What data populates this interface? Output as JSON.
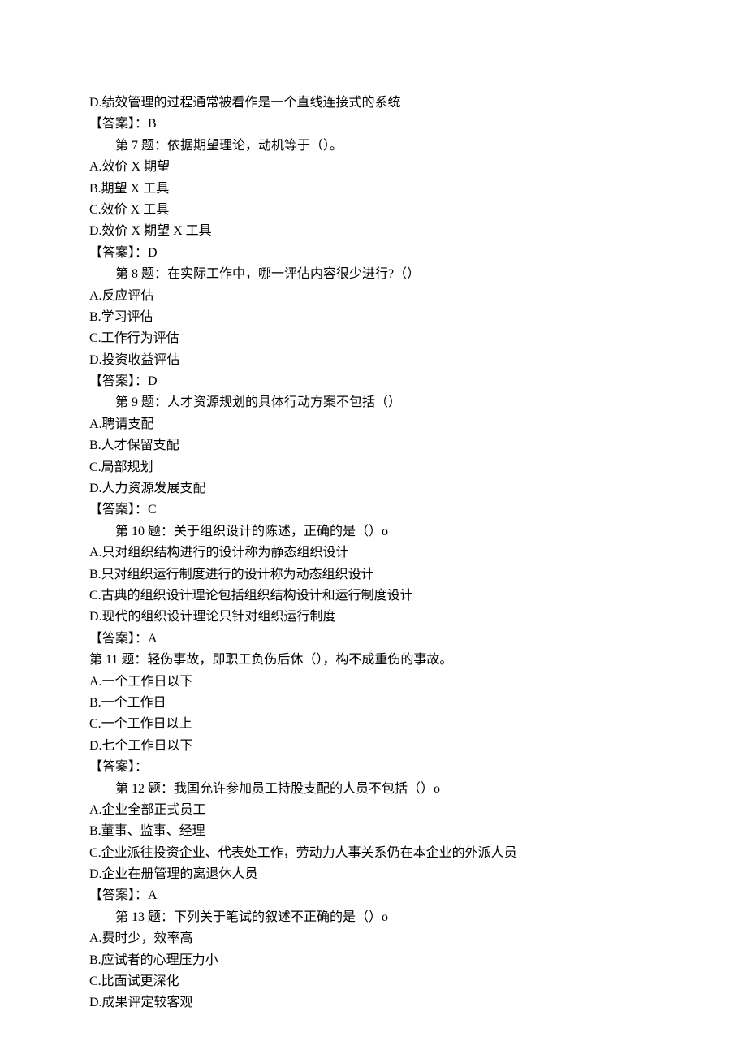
{
  "lines": [
    {
      "text": "D.绩效管理的过程通常被看作是一个直线连接式的系统",
      "indent": false
    },
    {
      "text": "【答案】：B",
      "indent": false
    },
    {
      "text": "第 7 题：依据期望理论，动机等于（）。",
      "indent": true
    },
    {
      "text": "A.效价 X 期望",
      "indent": false
    },
    {
      "text": "B.期望 X 工具",
      "indent": false
    },
    {
      "text": "C.效价 X 工具",
      "indent": false
    },
    {
      "text": "D.效价 X 期望 X 工具",
      "indent": false
    },
    {
      "text": "【答案】：D",
      "indent": false
    },
    {
      "text": "第 8 题：在实际工作中，哪一评估内容很少进行?（）",
      "indent": true
    },
    {
      "text": "A.反应评估",
      "indent": false
    },
    {
      "text": "B.学习评估",
      "indent": false
    },
    {
      "text": "C.工作行为评估",
      "indent": false
    },
    {
      "text": "D.投资收益评估",
      "indent": false
    },
    {
      "text": "【答案】：D",
      "indent": false
    },
    {
      "text": "第 9 题：人才资源规划的具体行动方案不包括（）",
      "indent": true
    },
    {
      "text": "A.聘请支配",
      "indent": false
    },
    {
      "text": "B.人才保留支配",
      "indent": false
    },
    {
      "text": "C.局部规划",
      "indent": false
    },
    {
      "text": "D.人力资源发展支配",
      "indent": false
    },
    {
      "text": "【答案】：C",
      "indent": false
    },
    {
      "text": "第 10 题：关于组织设计的陈述，正确的是（）o",
      "indent": true
    },
    {
      "text": "A.只对组织结构进行的设计称为静态组织设计",
      "indent": false
    },
    {
      "text": "B.只对组织运行制度进行的设计称为动态组织设计",
      "indent": false
    },
    {
      "text": "C.古典的组织设计理论包括组织结构设计和运行制度设计",
      "indent": false
    },
    {
      "text": "D.现代的组织设计理论只针对组织运行制度",
      "indent": false
    },
    {
      "text": "【答案】：A",
      "indent": false
    },
    {
      "text": "第 11 题：轻伤事故，即职工负伤后休（），构不成重伤的事故。",
      "indent": false
    },
    {
      "text": "A.一个工作日以下",
      "indent": false
    },
    {
      "text": "B.一个工作日",
      "indent": false
    },
    {
      "text": "C.一个工作日以上",
      "indent": false
    },
    {
      "text": "D.七个工作日以下",
      "indent": false
    },
    {
      "text": "【答案】：",
      "indent": false
    },
    {
      "text": "第 12 题：我国允许参加员工持股支配的人员不包括（）o",
      "indent": true
    },
    {
      "text": "A.企业全部正式员工",
      "indent": false
    },
    {
      "text": "B.董事、监事、经理",
      "indent": false
    },
    {
      "text": "C.企业派往投资企业、代表处工作，劳动力人事关系仍在本企业的外派人员",
      "indent": false
    },
    {
      "text": "D.企业在册管理的离退休人员",
      "indent": false
    },
    {
      "text": "【答案】：A",
      "indent": false
    },
    {
      "text": "第 13 题：下列关于笔试的叙述不正确的是（）o",
      "indent": true
    },
    {
      "text": "A.费时少，效率高",
      "indent": false
    },
    {
      "text": "B.应试者的心理压力小",
      "indent": false
    },
    {
      "text": "C.比面试更深化",
      "indent": false
    },
    {
      "text": "D.成果评定较客观",
      "indent": false
    }
  ]
}
